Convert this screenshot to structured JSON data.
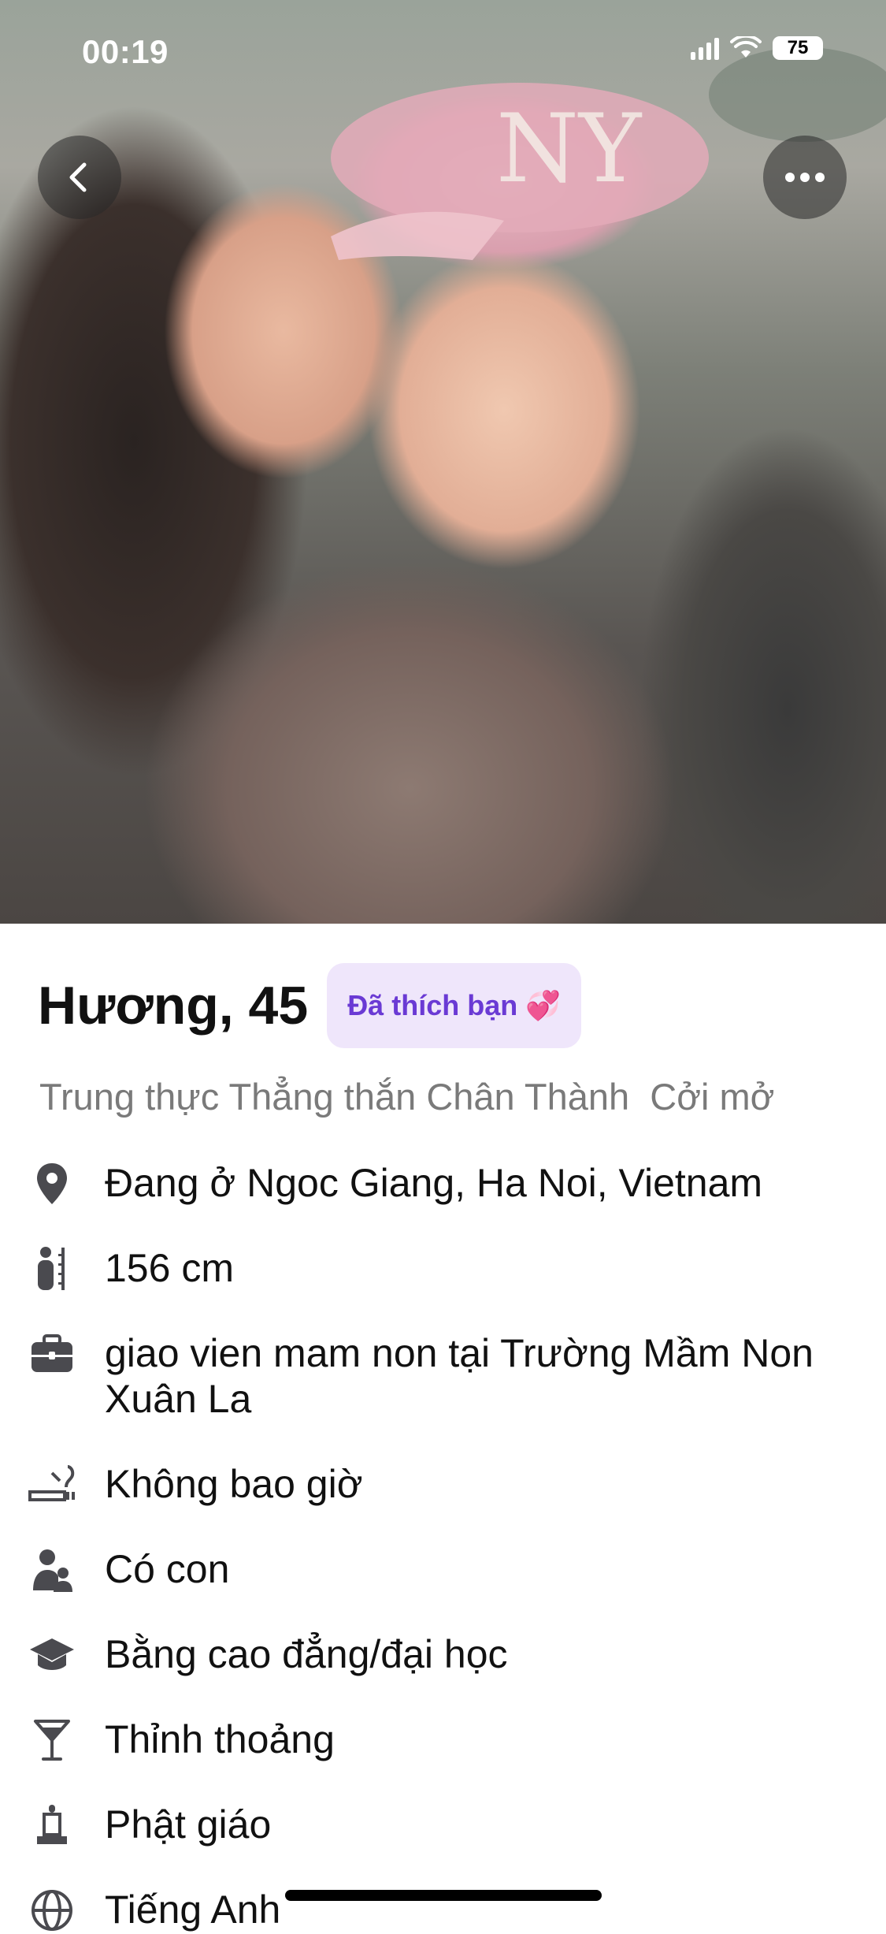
{
  "status_bar": {
    "time": "00:19",
    "battery": "75"
  },
  "profile": {
    "name_age": "Hương, 45",
    "liked_badge": "Đã thích bạn 💞",
    "tags": "Trung thực Thẳng thắn Chân Thành  Cởi mở"
  },
  "details": [
    {
      "icon": "location-pin-icon",
      "text": "Đang ở Ngoc Giang, Ha Noi, Vietnam"
    },
    {
      "icon": "height-icon",
      "text": "156 cm"
    },
    {
      "icon": "briefcase-icon",
      "text": "giao vien mam non tại Trường Mầm Non Xuân La"
    },
    {
      "icon": "smoking-icon",
      "text": "Không bao giờ"
    },
    {
      "icon": "children-icon",
      "text": "Có con"
    },
    {
      "icon": "graduation-cap-icon",
      "text": "Bằng cao đẳng/đại học"
    },
    {
      "icon": "cocktail-glass-icon",
      "text": "Thỉnh thoảng"
    },
    {
      "icon": "religion-icon",
      "text": "Phật giáo"
    },
    {
      "icon": "globe-icon",
      "text": "Tiếng Anh"
    }
  ],
  "colors": {
    "badge_bg": "#efe6fb",
    "badge_text": "#6a3ad4",
    "secondary_text": "#7a7a7a"
  }
}
